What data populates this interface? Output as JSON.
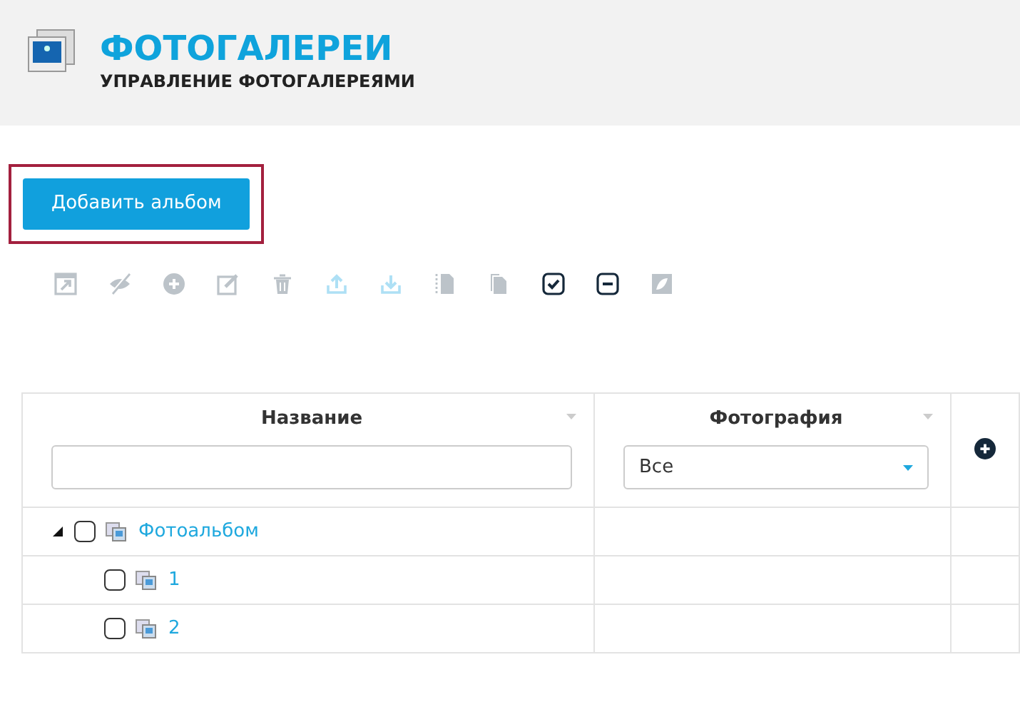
{
  "header": {
    "title": "ФОТОГАЛЕРЕИ",
    "subtitle": "УПРАВЛЕНИЕ ФОТОГАЛЕРЕЯМИ"
  },
  "add_button": {
    "label": "Добавить альбом",
    "focused": true
  },
  "toolbar": [
    {
      "kind": "open",
      "disabled": true
    },
    {
      "kind": "hide",
      "disabled": true
    },
    {
      "kind": "add",
      "disabled": true
    },
    {
      "kind": "edit",
      "disabled": true
    },
    {
      "kind": "delete",
      "disabled": true
    },
    {
      "kind": "upload",
      "disabled": true
    },
    {
      "kind": "download",
      "disabled": true
    },
    {
      "kind": "cut",
      "disabled": true
    },
    {
      "kind": "copy",
      "disabled": true
    },
    {
      "kind": "select-all",
      "disabled": false
    },
    {
      "kind": "deselect",
      "disabled": false
    },
    {
      "kind": "paste",
      "disabled": true
    }
  ],
  "table": {
    "columns": [
      {
        "label": "Название",
        "filter": {
          "kind": "text"
        }
      },
      {
        "label": "Фотография",
        "filter": {
          "kind": "select",
          "value": "Все"
        }
      }
    ],
    "rows": [
      {
        "name": "Фотоальбом",
        "checked": false,
        "expanded": true,
        "children": [
          {
            "name": "1",
            "checked": false
          },
          {
            "name": "2",
            "checked": false
          }
        ]
      }
    ]
  }
}
